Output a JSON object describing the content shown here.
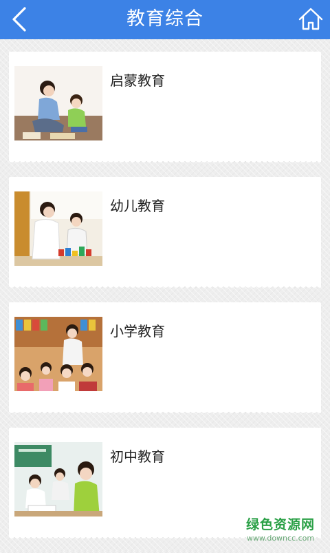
{
  "header": {
    "title": "教育综合",
    "back_icon": "chevron-left-icon",
    "home_icon": "home-icon",
    "color": "#3c82e6"
  },
  "items": [
    {
      "label": "启蒙教育"
    },
    {
      "label": "幼儿教育"
    },
    {
      "label": "小学教育"
    },
    {
      "label": "初中教育"
    }
  ],
  "watermark": {
    "main": "绿色资源网",
    "sub": "www.downcc.com"
  }
}
